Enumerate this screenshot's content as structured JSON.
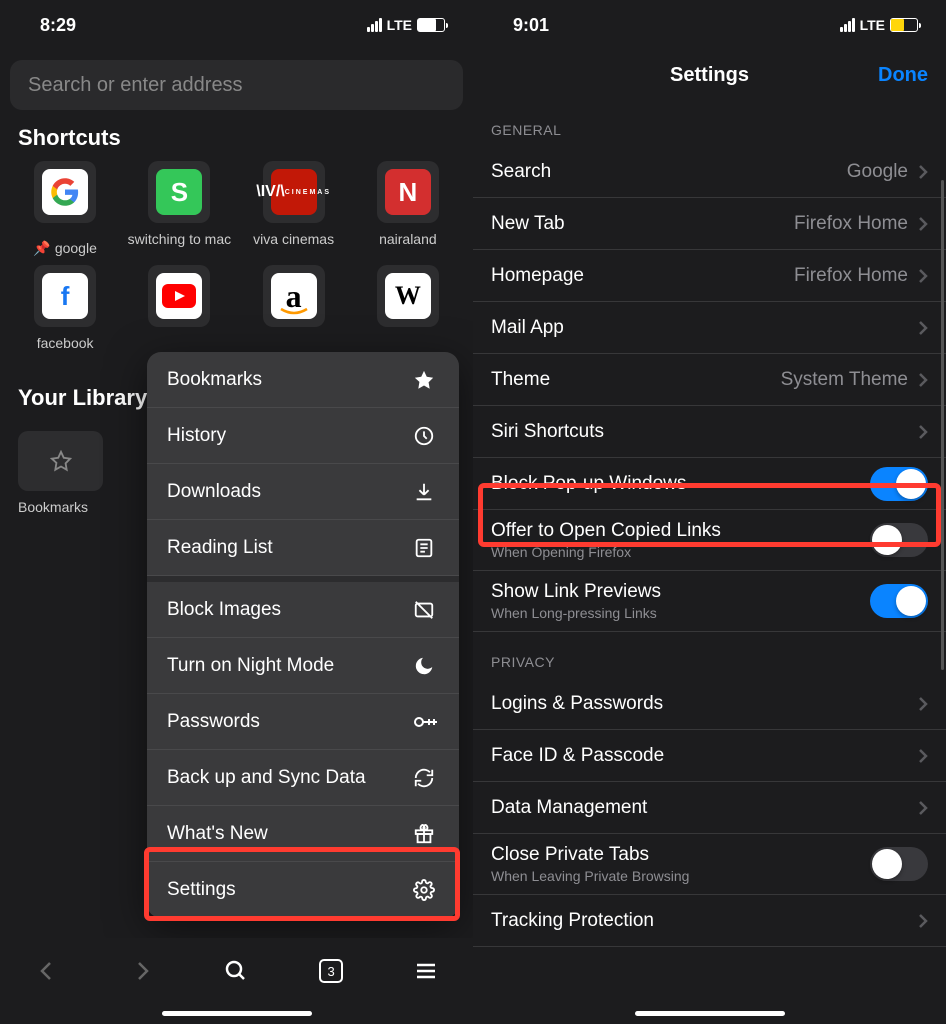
{
  "left": {
    "time": "8:29",
    "network": "LTE",
    "search_placeholder": "Search or enter address",
    "shortcuts_title": "Shortcuts",
    "shortcuts": [
      {
        "label": "google",
        "pinned": true,
        "badge": "G"
      },
      {
        "label": "switching to mac",
        "badge": "S"
      },
      {
        "label": "viva cinemas",
        "badge": "VIVA"
      },
      {
        "label": "nairaland",
        "badge": "N"
      },
      {
        "label": "facebook",
        "badge": "f"
      },
      {
        "label": "",
        "badge": "yt"
      },
      {
        "label": "",
        "badge": "a"
      },
      {
        "label": "",
        "badge": "W"
      }
    ],
    "library_title": "Your Library",
    "library_item": "Bookmarks",
    "tab_count": "3",
    "menu": [
      {
        "label": "Bookmarks",
        "icon": "star"
      },
      {
        "label": "History",
        "icon": "clock"
      },
      {
        "label": "Downloads",
        "icon": "download"
      },
      {
        "label": "Reading List",
        "icon": "reading"
      },
      {
        "label": "Block Images",
        "icon": "no-image"
      },
      {
        "label": "Turn on Night Mode",
        "icon": "moon"
      },
      {
        "label": "Passwords",
        "icon": "key"
      },
      {
        "label": "Back up and Sync Data",
        "icon": "sync"
      },
      {
        "label": "What's New",
        "icon": "gift"
      },
      {
        "label": "Settings",
        "icon": "gear"
      }
    ]
  },
  "right": {
    "time": "9:01",
    "network": "LTE",
    "title": "Settings",
    "done": "Done",
    "sections": {
      "general_caption": "GENERAL",
      "privacy_caption": "PRIVACY"
    },
    "general": [
      {
        "label": "Search",
        "value": "Google",
        "chevron": true
      },
      {
        "label": "New Tab",
        "value": "Firefox Home",
        "chevron": true
      },
      {
        "label": "Homepage",
        "value": "Firefox Home",
        "chevron": true
      },
      {
        "label": "Mail App",
        "value": "",
        "chevron": true
      },
      {
        "label": "Theme",
        "value": "System Theme",
        "chevron": true
      },
      {
        "label": "Siri Shortcuts",
        "value": "",
        "chevron": true
      },
      {
        "label": "Block Pop-up Windows",
        "toggle": "on"
      },
      {
        "label": "Offer to Open Copied Links",
        "sub": "When Opening Firefox",
        "toggle": "off"
      },
      {
        "label": "Show Link Previews",
        "sub": "When Long-pressing Links",
        "toggle": "on"
      }
    ],
    "privacy": [
      {
        "label": "Logins & Passwords",
        "chevron": true
      },
      {
        "label": "Face ID & Passcode",
        "chevron": true
      },
      {
        "label": "Data Management",
        "chevron": true
      },
      {
        "label": "Close Private Tabs",
        "sub": "When Leaving Private Browsing",
        "toggle": "off"
      },
      {
        "label": "Tracking Protection",
        "chevron": true
      }
    ]
  }
}
